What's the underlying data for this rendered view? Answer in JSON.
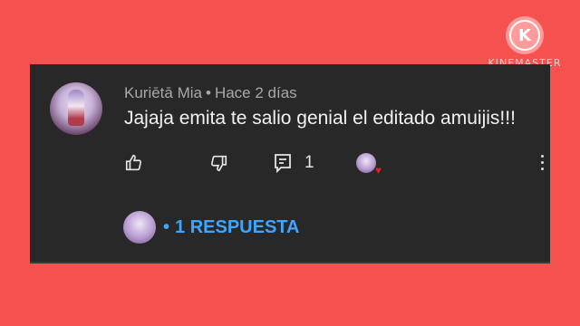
{
  "watermark": {
    "logo_letter": "K",
    "brand": "KINEMASTER"
  },
  "comment": {
    "author": "Kuriētā Mia",
    "separator": "•",
    "time": "Hace 2 días",
    "text": "Jajaja emita te salio genial el editado amuijis!!!",
    "reply_count": "1",
    "icons": {
      "like": "thumbs-up-icon",
      "dislike": "thumbs-down-icon",
      "reply": "reply-icon",
      "creator_heart": "heart-icon",
      "more": "more-vertical-icon"
    }
  },
  "replies": {
    "bullet": "•",
    "label": "1 RESPUESTA"
  },
  "colors": {
    "background": "#f4514f",
    "card": "#282828",
    "link": "#3ea6ff",
    "heart": "#e51b2b"
  }
}
